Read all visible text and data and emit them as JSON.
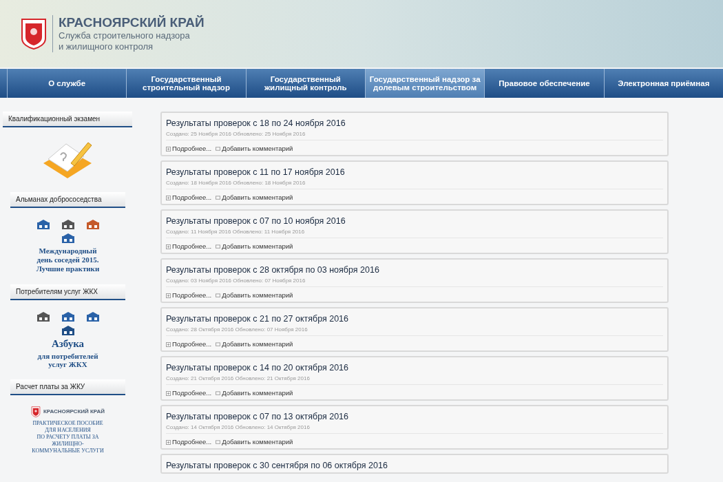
{
  "header": {
    "region": "КРАСНОЯРСКИЙ КРАЙ",
    "subtitle_lines": [
      "Служба строительного надзора",
      "и жилищного контроля"
    ]
  },
  "nav": [
    {
      "label": "О службе",
      "selected": false
    },
    {
      "label": "Государственный строительный надзор",
      "selected": false
    },
    {
      "label": "Государственный жилищный контроль",
      "selected": false
    },
    {
      "label": "Государственный надзор за долевым строительством",
      "selected": true
    },
    {
      "label": "Правовое обеспечение",
      "selected": false
    },
    {
      "label": "Электронная приёмная",
      "selected": false
    }
  ],
  "sidebar": [
    {
      "title": "Квалификационный экзамен",
      "banner": {
        "kind": "exam"
      }
    },
    {
      "title": "Альманах добрососедства",
      "banner": {
        "kind": "almanac",
        "lines": [
          "Международный",
          "день соседей 2015.",
          "Лучшие практики"
        ]
      }
    },
    {
      "title": "Потребителям услуг ЖКХ",
      "banner": {
        "kind": "abc",
        "heading": "Азбука",
        "lines": [
          "для потребителей",
          "услуг ЖКХ"
        ]
      }
    },
    {
      "title": "Расчет платы за ЖКУ",
      "banner": {
        "kind": "guide",
        "logo_title": "КРАСНОЯРСКИЙ КРАЙ",
        "lines": [
          "ПРАКТИЧЕСКОЕ ПОСОБИЕ",
          "ДЛЯ НАСЕЛЕНИЯ",
          "ПО РАСЧЕТУ ПЛАТЫ ЗА",
          "ЖИЛИЩНО-",
          "КОММУНАЛЬНЫЕ УСЛУГИ"
        ]
      }
    }
  ],
  "articles": [
    {
      "title": "Результаты проверок с 18 по 24 ноября 2016",
      "meta": "Создано: 25 Ноября 2016 Обновлено: 25 Ноября 2016",
      "more": "Подробнее...",
      "comment": "Добавить комментарий"
    },
    {
      "title": "Результаты проверок с 11 по 17 ноября 2016",
      "meta": "Создано: 18 Ноября 2016 Обновлено: 18 Ноября 2016",
      "more": "Подробнее...",
      "comment": "Добавить комментарий"
    },
    {
      "title": "Результаты проверок с 07 по 10 ноября 2016",
      "meta": "Создано: 11 Ноября 2016 Обновлено: 11 Ноября 2016",
      "more": "Подробнее...",
      "comment": "Добавить комментарий"
    },
    {
      "title": "Результаты проверок с 28 октября по 03 ноября 2016",
      "meta": "Создано: 03 Ноября 2016 Обновлено: 07 Ноября 2016",
      "more": "Подробнее...",
      "comment": "Добавить комментарий"
    },
    {
      "title": "Результаты проверок с 21 по 27 октября 2016",
      "meta": "Создано: 28 Октября 2016 Обновлено: 07 Ноября 2016",
      "more": "Подробнее...",
      "comment": "Добавить комментарий"
    },
    {
      "title": "Результаты проверок с 14 по 20 октября 2016",
      "meta": "Создано: 21 Октября 2016 Обновлено: 21 Октября 2016",
      "more": "Подробнее...",
      "comment": "Добавить комментарий"
    },
    {
      "title": "Результаты проверок с 07 по 13 октября 2016",
      "meta": "Создано: 14 Октября 2016 Обновлено: 14 Октября 2016",
      "more": "Подробнее...",
      "comment": "Добавить комментарий"
    },
    {
      "title": "Результаты проверок с 30 сентября по 06 октября 2016"
    }
  ]
}
